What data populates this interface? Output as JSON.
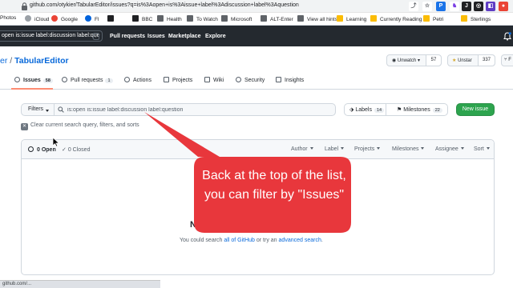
{
  "browser": {
    "url": "github.com/otykier/TabularEditor/issues?q=is%3Aopen+is%3Aissue+label%3Adiscussion+label%3Aquestion",
    "status_text": "github.com/..."
  },
  "bookmarks": [
    {
      "label": "Photos",
      "color": "#4285f4"
    },
    {
      "label": "iCloud",
      "color": "#9aa0a6"
    },
    {
      "label": "Google",
      "color": "#ea4335"
    },
    {
      "label": "Fl",
      "color": "#0063dc"
    },
    {
      "label": "BBC",
      "color": "#202124"
    },
    {
      "label": "Health",
      "color": "#34a853"
    },
    {
      "label": "To Watch",
      "color": "#e8453c"
    },
    {
      "label": "Microsoft",
      "color": "#f25022"
    },
    {
      "label": "ALT-Enter",
      "color": "#fbbc04"
    },
    {
      "label": "View all hints",
      "color": "#5f6368"
    },
    {
      "label": "Learning",
      "color": "#fbbc04"
    },
    {
      "label": "Currently Reading",
      "color": "#fbbc04"
    },
    {
      "label": "Petri",
      "color": "#fbbc04"
    },
    {
      "label": "Sterlings",
      "color": "#fbbc04"
    }
  ],
  "github_header": {
    "search_value": "open is:issue label:discussion label:que",
    "search_shortcut": "/",
    "nav": [
      "Pull requests",
      "Issues",
      "Marketplace",
      "Explore"
    ]
  },
  "repo": {
    "owner_fragment": "er",
    "separator": "/",
    "name": "TabularEditor",
    "unwatch_label": "Unwatch",
    "unwatch_count": "57",
    "unstar_label": "Unstar",
    "unstar_count": "337",
    "fork_label": "F"
  },
  "tabs": [
    {
      "label": "Issues",
      "badge": "58"
    },
    {
      "label": "Pull requests",
      "badge": "1"
    },
    {
      "label": "Actions",
      "badge": ""
    },
    {
      "label": "Projects",
      "badge": ""
    },
    {
      "label": "Wiki",
      "badge": ""
    },
    {
      "label": "Security",
      "badge": ""
    },
    {
      "label": "Insights",
      "badge": ""
    }
  ],
  "filters": {
    "filters_label": "Filters",
    "query_value": "is:open is:issue label:discussion label:question",
    "labels_label": "Labels",
    "labels_count": "14",
    "milestones_label": "Milestones",
    "milestones_count": "22",
    "new_issue_label": "New issue",
    "clear_label": "Clear current search query, filters, and sorts"
  },
  "issues_header": {
    "open_label": "0 Open",
    "closed_label": "0 Closed",
    "sort_items": [
      "Author",
      "Label",
      "Projects",
      "Milestones",
      "Assignee",
      "Sort"
    ]
  },
  "blank_state": {
    "title_fragment": "No",
    "desc_prefix": "You could search",
    "desc_link1": "all of GitHub",
    "desc_middle": "or try an",
    "desc_link2": "advanced search",
    "desc_suffix": "."
  },
  "callout": {
    "text": "Back at the top of the list, you can filter by \"Issues\"",
    "color": "#e8373c"
  }
}
